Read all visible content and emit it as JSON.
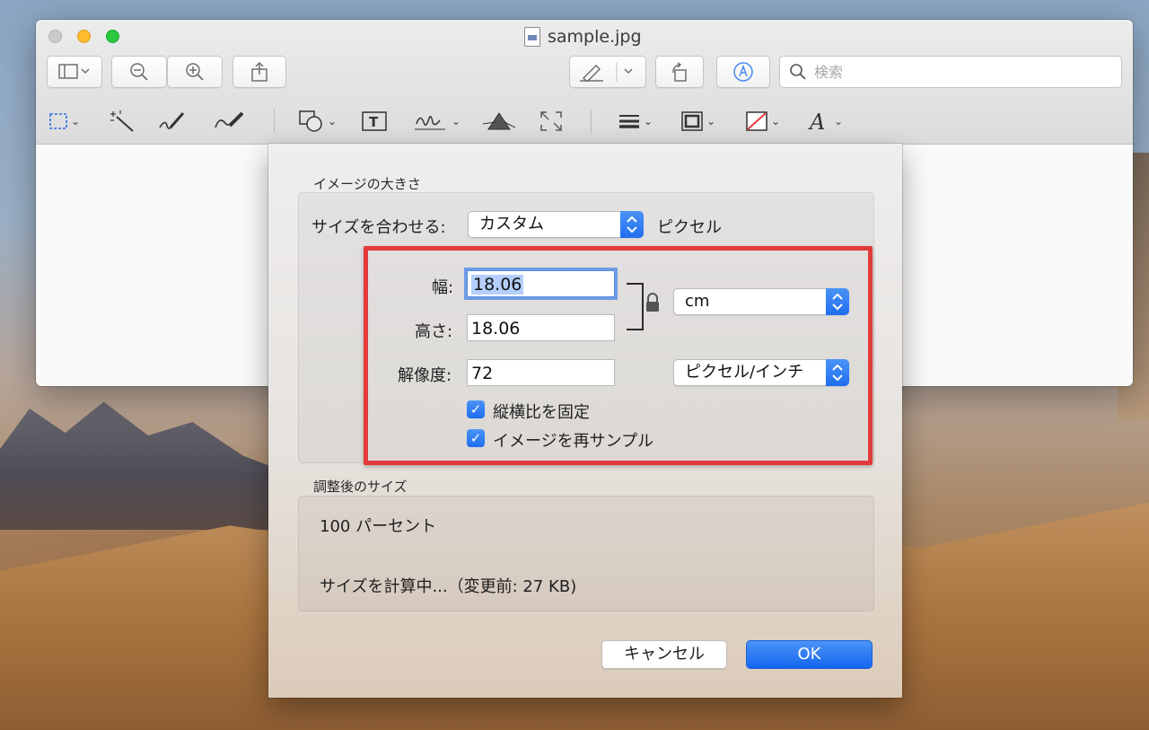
{
  "window": {
    "filename": "sample.jpg"
  },
  "toolbar": {
    "search_placeholder": "検索"
  },
  "dialog": {
    "image_size_section": "イメージの大きさ",
    "fit_label": "サイズを合わせる:",
    "fit_value": "カスタム",
    "fit_unit": "ピクセル",
    "width_label": "幅:",
    "width_value": "18.06",
    "height_label": "高さ:",
    "height_value": "18.06",
    "resolution_label": "解像度:",
    "resolution_value": "72",
    "size_unit": "cm",
    "resolution_unit": "ピクセル/インチ",
    "checkbox_aspect": "縦横比を固定",
    "checkbox_resample": "イメージを再サンプル",
    "result_section": "調整後のサイズ",
    "result_percent": "100 パーセント",
    "result_size": "サイズを計算中...（変更前: 27 KB)",
    "cancel_label": "キャンセル",
    "ok_label": "OK"
  },
  "colors": {
    "accent": "#1f6ef0",
    "highlight": "#e23b3b"
  }
}
